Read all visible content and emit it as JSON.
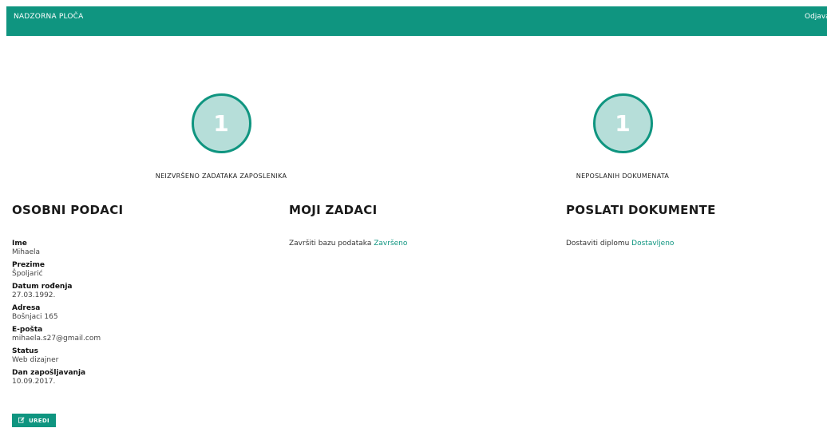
{
  "nav": {
    "title": "NADZORNA PLOČA",
    "logout_label": "Odjava"
  },
  "stats": [
    {
      "value": "1",
      "label": "NEIZVRŠENO ZADATAKA ZAPOSLENIKA"
    },
    {
      "value": "1",
      "label": "NEPOSLANIH DOKUMENATA"
    }
  ],
  "personal": {
    "heading": "OSOBNI PODACI",
    "fields": [
      {
        "label": "Ime",
        "value": "Mihaela"
      },
      {
        "label": "Prezime",
        "value": "Špoljarić"
      },
      {
        "label": "Datum rođenja",
        "value": "27.03.1992."
      },
      {
        "label": "Adresa",
        "value": "Bošnjaci 165"
      },
      {
        "label": "E-pošta",
        "value": "mihaela.s27@gmail.com"
      },
      {
        "label": "Status",
        "value": "Web dizajner"
      },
      {
        "label": "Dan zapošljavanja",
        "value": "10.09.2017."
      }
    ],
    "edit_label": "UREDI"
  },
  "tasks": {
    "heading": "MOJI ZADACI",
    "items": [
      {
        "text": "Završiti bazu podataka",
        "status": "Završeno"
      }
    ]
  },
  "documents": {
    "heading": "POSLATI DOKUMENTE",
    "items": [
      {
        "text": "Dostaviti diplomu",
        "status": "Dostavljeno"
      }
    ]
  },
  "colors": {
    "accent": "#0f9580",
    "circle_fill": "#b6ded9"
  }
}
